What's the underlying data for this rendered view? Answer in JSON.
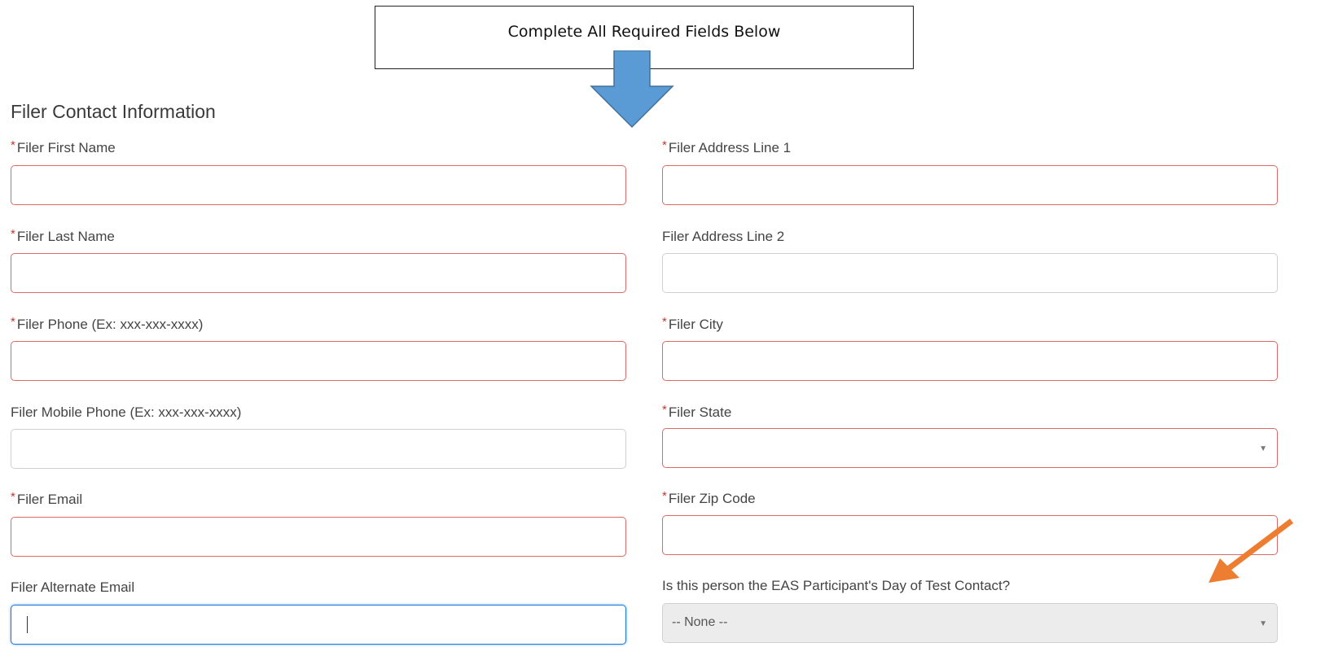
{
  "callout": {
    "text": "Complete All Required Fields Below"
  },
  "section": {
    "title": "Filer Contact Information"
  },
  "required_marker": "*",
  "left_fields": [
    {
      "label": "Filer First Name",
      "required": true,
      "value": ""
    },
    {
      "label": "Filer Last Name",
      "required": true,
      "value": ""
    },
    {
      "label": "Filer Phone (Ex: xxx-xxx-xxxx)",
      "required": true,
      "value": ""
    },
    {
      "label": "Filer Mobile Phone (Ex: xxx-xxx-xxxx)",
      "required": false,
      "value": ""
    },
    {
      "label": "Filer Email",
      "required": true,
      "value": ""
    },
    {
      "label": "Filer Alternate Email",
      "required": false,
      "value": "",
      "focused": true
    }
  ],
  "right_fields": [
    {
      "label": "Filer Address Line 1",
      "required": true,
      "value": ""
    },
    {
      "label": "Filer Address Line 2",
      "required": false,
      "value": ""
    },
    {
      "label": "Filer City",
      "required": true,
      "value": ""
    },
    {
      "label": "Filer State",
      "required": true,
      "value": "",
      "type": "select"
    },
    {
      "label": "Filer Zip Code",
      "required": true,
      "value": ""
    },
    {
      "label": "Is this person the EAS Participant's Day of Test Contact?",
      "required": false,
      "type": "select",
      "disabled": true,
      "selected": "-- None --"
    }
  ],
  "caret_glyph": "▼",
  "colors": {
    "required": "#c23934",
    "invalid_border": "#d86a6a",
    "focus_border": "#1b7ad9",
    "blue_arrow": "#5b9bd5",
    "orange_arrow": "#ed7d31"
  }
}
